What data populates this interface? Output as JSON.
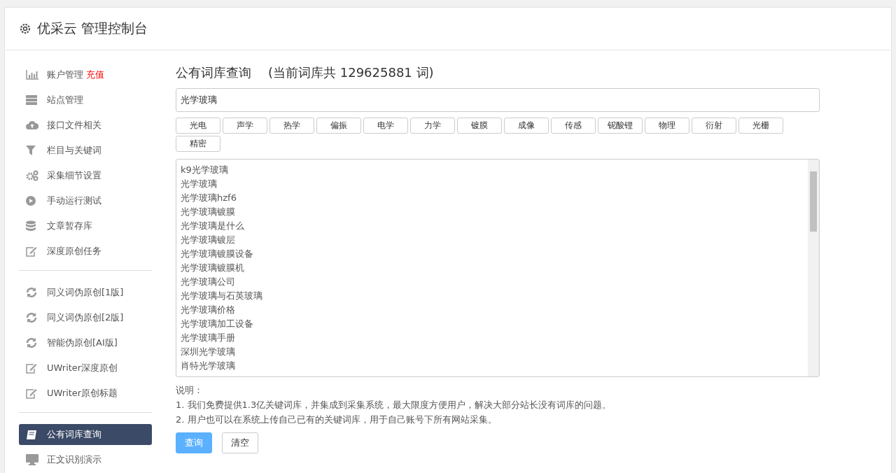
{
  "header": {
    "title": "优采云 管理控制台"
  },
  "sidebar": {
    "sections": [
      {
        "items": [
          {
            "label": "账户管理",
            "badge": "充值",
            "selected": false
          },
          {
            "label": "站点管理",
            "selected": false
          },
          {
            "label": "接口文件相关",
            "selected": false
          },
          {
            "label": "栏目与关键词",
            "selected": false
          },
          {
            "label": "采集细节设置",
            "selected": false
          },
          {
            "label": "手动运行测试",
            "selected": false
          },
          {
            "label": "文章暂存库",
            "selected": false
          },
          {
            "label": "深度原创任务",
            "selected": false
          }
        ]
      },
      {
        "items": [
          {
            "label": "同义词伪原创[1版]",
            "selected": false
          },
          {
            "label": "同义词伪原创[2版]",
            "selected": false
          },
          {
            "label": "智能伪原创[AI版]",
            "selected": false
          },
          {
            "label": "UWriter深度原创",
            "selected": false
          },
          {
            "label": "UWriter原创标题",
            "selected": false
          }
        ]
      },
      {
        "items": [
          {
            "label": "公有词库查询",
            "selected": true
          },
          {
            "label": "正文识别演示",
            "selected": false
          }
        ]
      }
    ]
  },
  "main": {
    "title": "公有词库查询",
    "subtitle": "(当前词库共 129625881 词)",
    "search": {
      "value": "光学玻璃"
    },
    "tags": [
      "光电",
      "声学",
      "热学",
      "偏振",
      "电学",
      "力学",
      "镀膜",
      "成像",
      "传感",
      "铌酸锂",
      "物理",
      "衍射",
      "光栅",
      "精密"
    ],
    "results": [
      "k9光学玻璃",
      "光学玻璃",
      "光学玻璃hzf6",
      "光学玻璃镀膜",
      "光学玻璃是什么",
      "光学玻璃镀层",
      "光学玻璃镀膜设备",
      "光学玻璃镀膜机",
      "光学玻璃公司",
      "光学玻璃与石英玻璃",
      "光学玻璃价格",
      "光学玻璃加工设备",
      "光学玻璃手册",
      "深圳光学玻璃",
      "肖特光学玻璃"
    ],
    "notes": {
      "heading": "说明：",
      "lines": [
        "1. 我们免费提供1.3亿关键词库，并集成到采集系统，最大限度方便用户，解决大部分站长没有词库的问题。",
        "2. 用户也可以在系统上传自己已有的关键词库，用于自己账号下所有网站采集。"
      ]
    },
    "buttons": [
      {
        "label": "查询",
        "kind": "primary"
      },
      {
        "label": "清空",
        "kind": "default"
      }
    ]
  }
}
